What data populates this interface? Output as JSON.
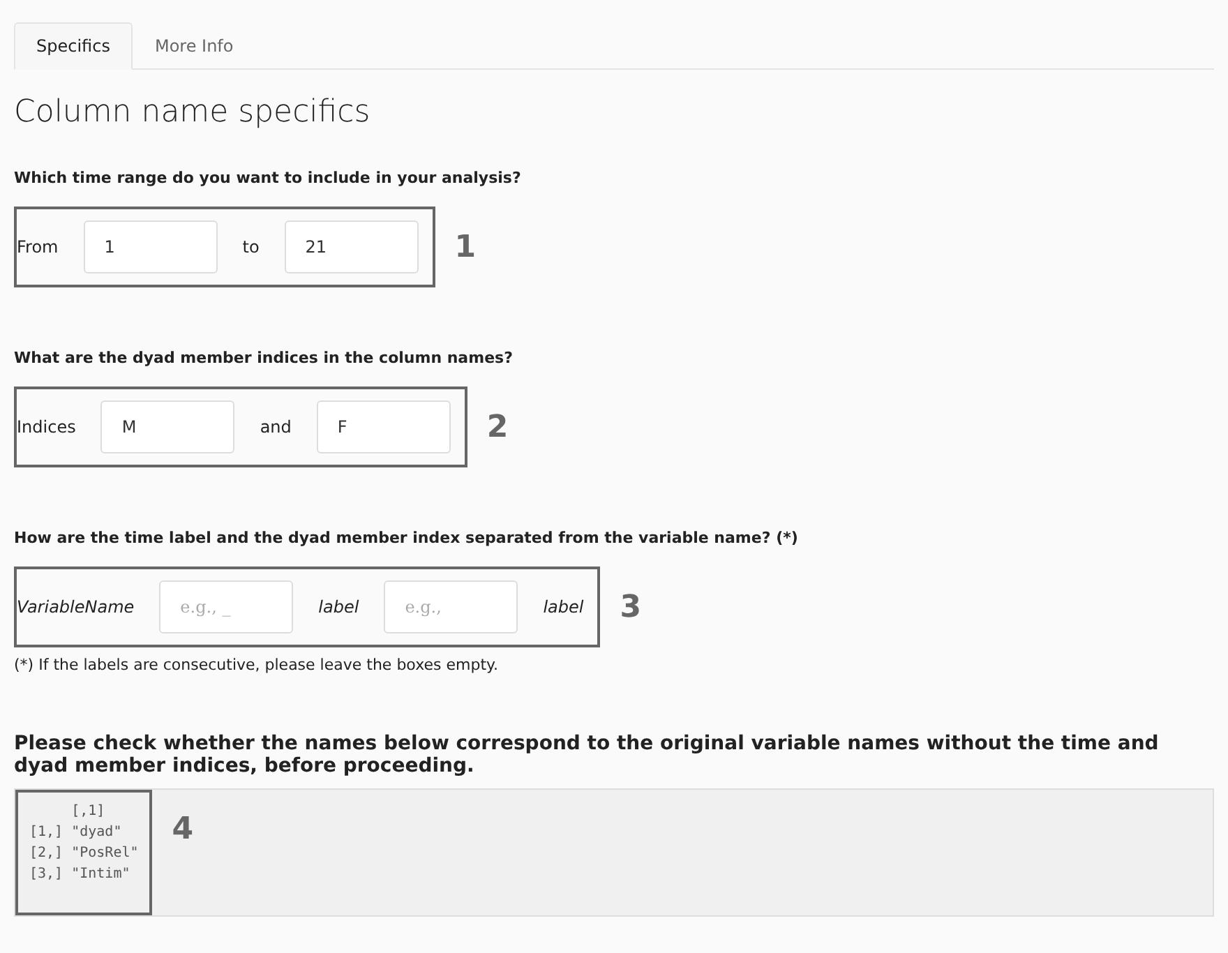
{
  "tabs": [
    {
      "label": "Specifics",
      "selected": true
    },
    {
      "label": "More Info",
      "selected": false
    }
  ],
  "heading": "Column name specifics",
  "sections": [
    {
      "question": "Which time range do you want to include in your analysis?",
      "marker": "1",
      "items": [
        {
          "kind": "label",
          "text": "From"
        },
        {
          "kind": "field",
          "value": "1"
        },
        {
          "kind": "label",
          "text": "to"
        },
        {
          "kind": "field",
          "value": "21"
        }
      ]
    },
    {
      "question": "What are the dyad member indices in the column names?",
      "marker": "2",
      "items": [
        {
          "kind": "label",
          "text": "Indices"
        },
        {
          "kind": "field",
          "value": "M"
        },
        {
          "kind": "label",
          "text": "and"
        },
        {
          "kind": "field",
          "value": "F"
        }
      ]
    },
    {
      "question": "How are the time label and the dyad member index separated from the variable name? (*)",
      "marker": "3",
      "items": [
        {
          "kind": "emphasis",
          "text": "VariableName"
        },
        {
          "kind": "field",
          "placeholder": "e.g., _"
        },
        {
          "kind": "emphasis",
          "text": "label"
        },
        {
          "kind": "field",
          "placeholder": "e.g.,"
        },
        {
          "kind": "emphasis",
          "text": "label"
        }
      ],
      "note": "(*) If the labels are consecutive, please leave the boxes empty."
    }
  ],
  "check_prompt": "Please check whether the names below correspond to the original variable names without the time and dyad member indices, before proceeding.",
  "output": {
    "marker": "4",
    "lines": [
      "     [,1]",
      "[1,] \"dyad\"",
      "[2,] \"PosRel\"",
      "[3,] \"Intim\""
    ]
  }
}
